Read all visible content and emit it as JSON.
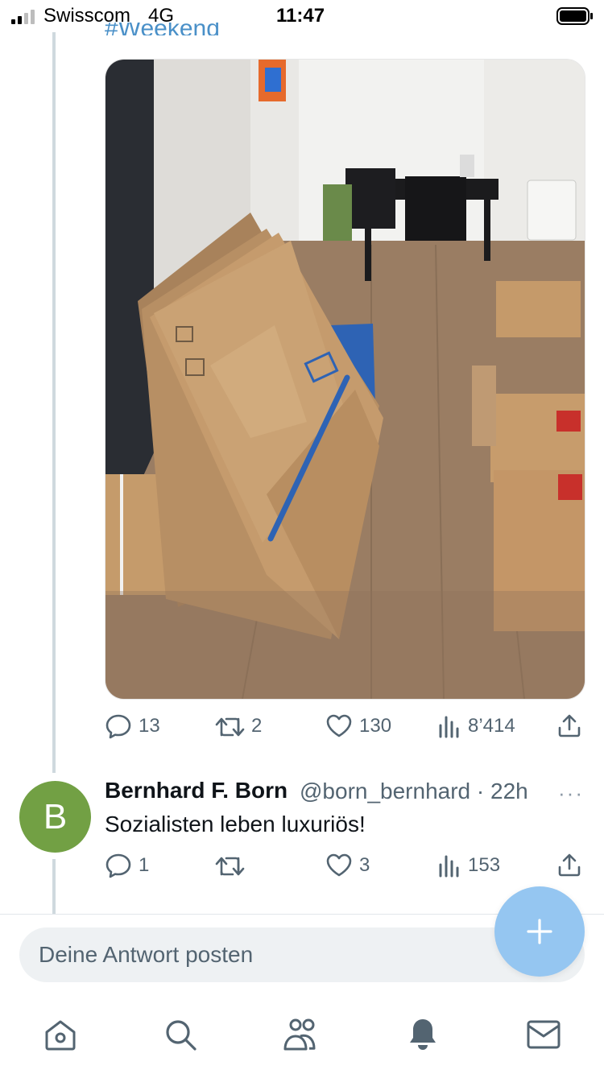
{
  "status_bar": {
    "carrier": "Swisscom",
    "network": "4G",
    "time": "11:47"
  },
  "parent_tweet": {
    "hashtag": "#Weekend",
    "image_alt": "Stapel flacher IKEA-Umzugskartons an der Wand, Umzugskisten, Esstisch im Hintergrund",
    "actions": {
      "replies": "13",
      "retweets": "2",
      "likes": "130",
      "views": "8’414"
    }
  },
  "reply_tweet": {
    "avatar_letter": "B",
    "avatar_color": "#72a044",
    "author_name": "Bernhard F. Born",
    "handle_time": "@born_bernhard · 22h",
    "more": "···",
    "text": "Sozialisten leben luxuriös!",
    "actions": {
      "replies": "1",
      "retweets": "",
      "likes": "3",
      "views": "153"
    }
  },
  "composer": {
    "placeholder": "Deine Antwort posten"
  },
  "tab_bar": {
    "icons": [
      "home-icon",
      "search-icon",
      "communities-icon",
      "notifications-icon",
      "messages-icon"
    ]
  },
  "colors": {
    "accent": "#1d9bf0",
    "fab": "#95c6f1",
    "muted": "#536471"
  }
}
